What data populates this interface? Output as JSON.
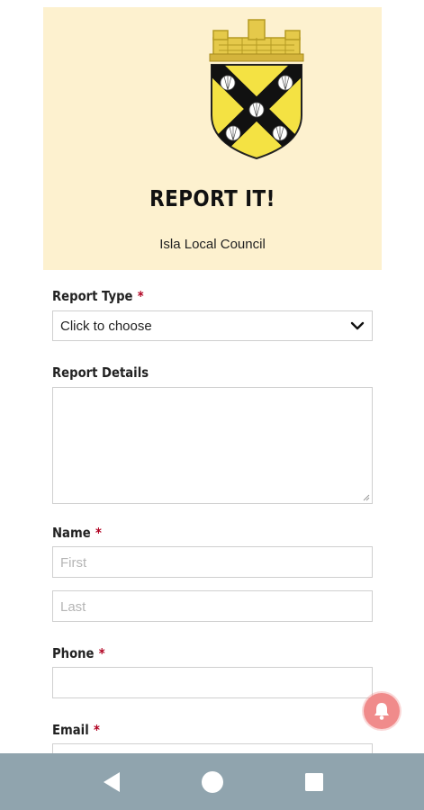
{
  "header": {
    "title": "REPORT IT!",
    "council": "Isla Local Council",
    "background_color": "#fdf1cf",
    "crest_icon": "coat-of-arms-icon"
  },
  "form": {
    "report_type": {
      "label": "Report Type",
      "required_mark": "*",
      "selected_value": "Click to choose"
    },
    "report_details": {
      "label": "Report Details",
      "value": ""
    },
    "name": {
      "label": "Name",
      "required_mark": "*",
      "first_placeholder": "First",
      "last_placeholder": "Last"
    },
    "phone": {
      "label": "Phone",
      "required_mark": "*",
      "value": ""
    },
    "email": {
      "label": "Email",
      "required_mark": "*",
      "value": ""
    }
  },
  "notification_button": {
    "icon": "bell-icon",
    "color": "#f08b8b"
  },
  "system_nav": {
    "background_color": "#90a4ae",
    "buttons": [
      "back-icon",
      "home-icon",
      "recents-icon"
    ]
  }
}
